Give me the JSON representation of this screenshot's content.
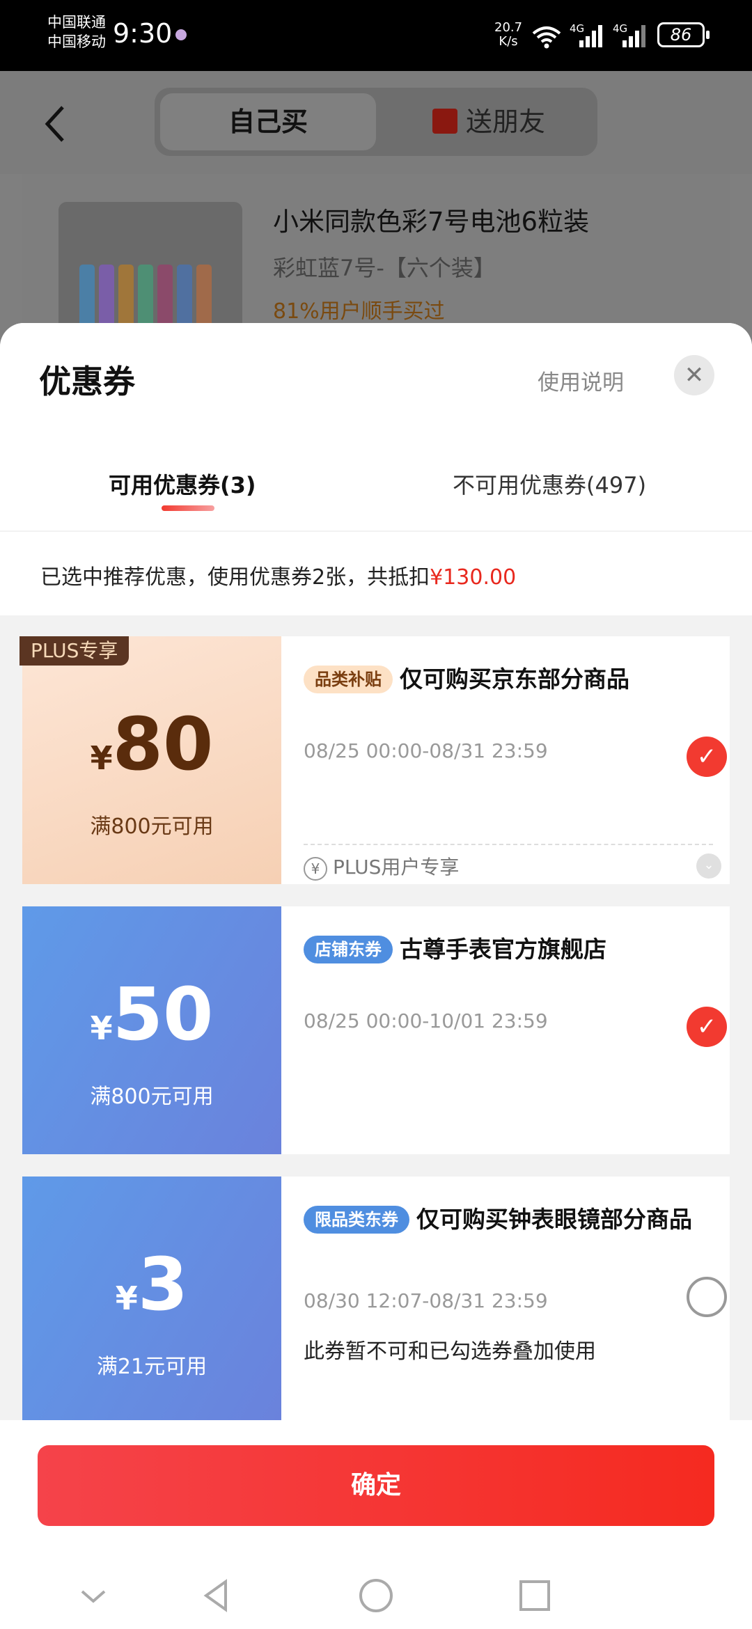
{
  "status_bar": {
    "carrier1": "中国联通",
    "carrier2": "中国移动",
    "time": "9:30",
    "net_speed": "20.7",
    "net_unit": "K/s",
    "sig1_label": "4G",
    "sig2_label": "4G",
    "battery": "86"
  },
  "page": {
    "tab_self": "自己买",
    "tab_gift": "送朋友",
    "product_title": "小米同款色彩7号电池6粒装",
    "product_variant": "彩虹蓝7号-【六个装】",
    "product_bought": "81%用户顺手买过"
  },
  "sheet": {
    "title": "优惠券",
    "usage_link": "使用说明",
    "tab_available": "可用优惠券(3)",
    "tab_unavailable": "不可用优惠券(497)",
    "summary_prefix": "已选中推荐优惠，使用优惠券2张，共抵扣",
    "summary_amount": "¥130.00"
  },
  "coupons": [
    {
      "badge": "PLUS专享",
      "currency": "¥",
      "amount": "80",
      "condition": "满800元可用",
      "tag": "品类补贴",
      "title": "仅可购买京东部分商品",
      "date": "08/25 00:00-08/31 23:59",
      "footer": "PLUS用户专享",
      "footer_icon": "¥",
      "selected": true
    },
    {
      "currency": "¥",
      "amount": "50",
      "condition": "满800元可用",
      "tag": "店铺东券",
      "title": "古尊手表官方旗舰店",
      "date": "08/25 00:00-10/01 23:59",
      "selected": true
    },
    {
      "currency": "¥",
      "amount": "3",
      "condition": "满21元可用",
      "tag": "限品类东券",
      "title": "仅可购买钟表眼镜部分商品",
      "date": "08/30 12:07-08/31 23:59",
      "note": "此券暂不可和已勾选券叠加使用",
      "selected": false
    }
  ],
  "footer": {
    "confirm": "确定"
  },
  "icons": {
    "back": "back-arrow-icon",
    "gift": "gift-icon",
    "close": "close-icon",
    "check": "checkmark-icon",
    "nav_down": "chevron-down-icon",
    "nav_back": "triangle-back-icon",
    "nav_home": "circle-home-icon",
    "nav_recent": "square-recent-icon"
  },
  "colors": {
    "accent_red": "#f23a30",
    "plus_brown": "#5b3522",
    "coupon_blue": "#5f9ae8"
  }
}
